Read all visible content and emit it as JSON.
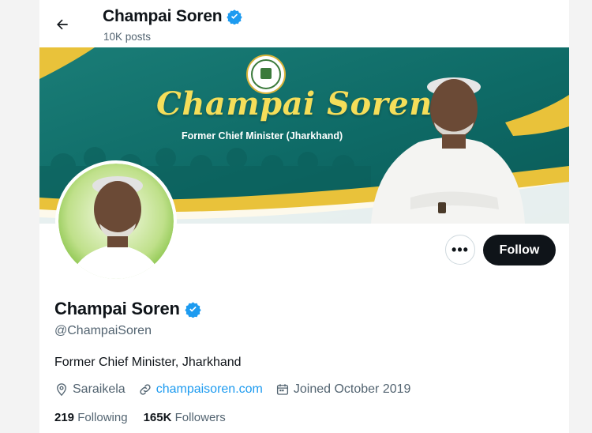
{
  "header": {
    "name": "Champai Soren",
    "posts": "10K posts"
  },
  "banner": {
    "title": "Champai Soren",
    "subtitle": "Former Chief Minister (Jharkhand)"
  },
  "actions": {
    "more": "•••",
    "follow": "Follow"
  },
  "profile": {
    "name": "Champai Soren",
    "handle": "@ChampaiSoren",
    "bio": "Former Chief Minister, Jharkhand",
    "location": "Saraikela",
    "website": "champaisoren.com",
    "joined": "Joined October 2019",
    "following_count": "219",
    "following_label": "Following",
    "followers_count": "165K",
    "followers_label": "Followers"
  },
  "icons": {
    "back": "arrow-left-icon",
    "verified": "verified-badge-icon",
    "location": "location-pin-icon",
    "link": "link-icon",
    "calendar": "calendar-icon"
  },
  "colors": {
    "verified": "#1d9bf0",
    "link": "#1d9bf0",
    "follow_bg": "#0f1419",
    "banner_teal": "#0f6f6b",
    "banner_gold": "#e9c23a"
  }
}
